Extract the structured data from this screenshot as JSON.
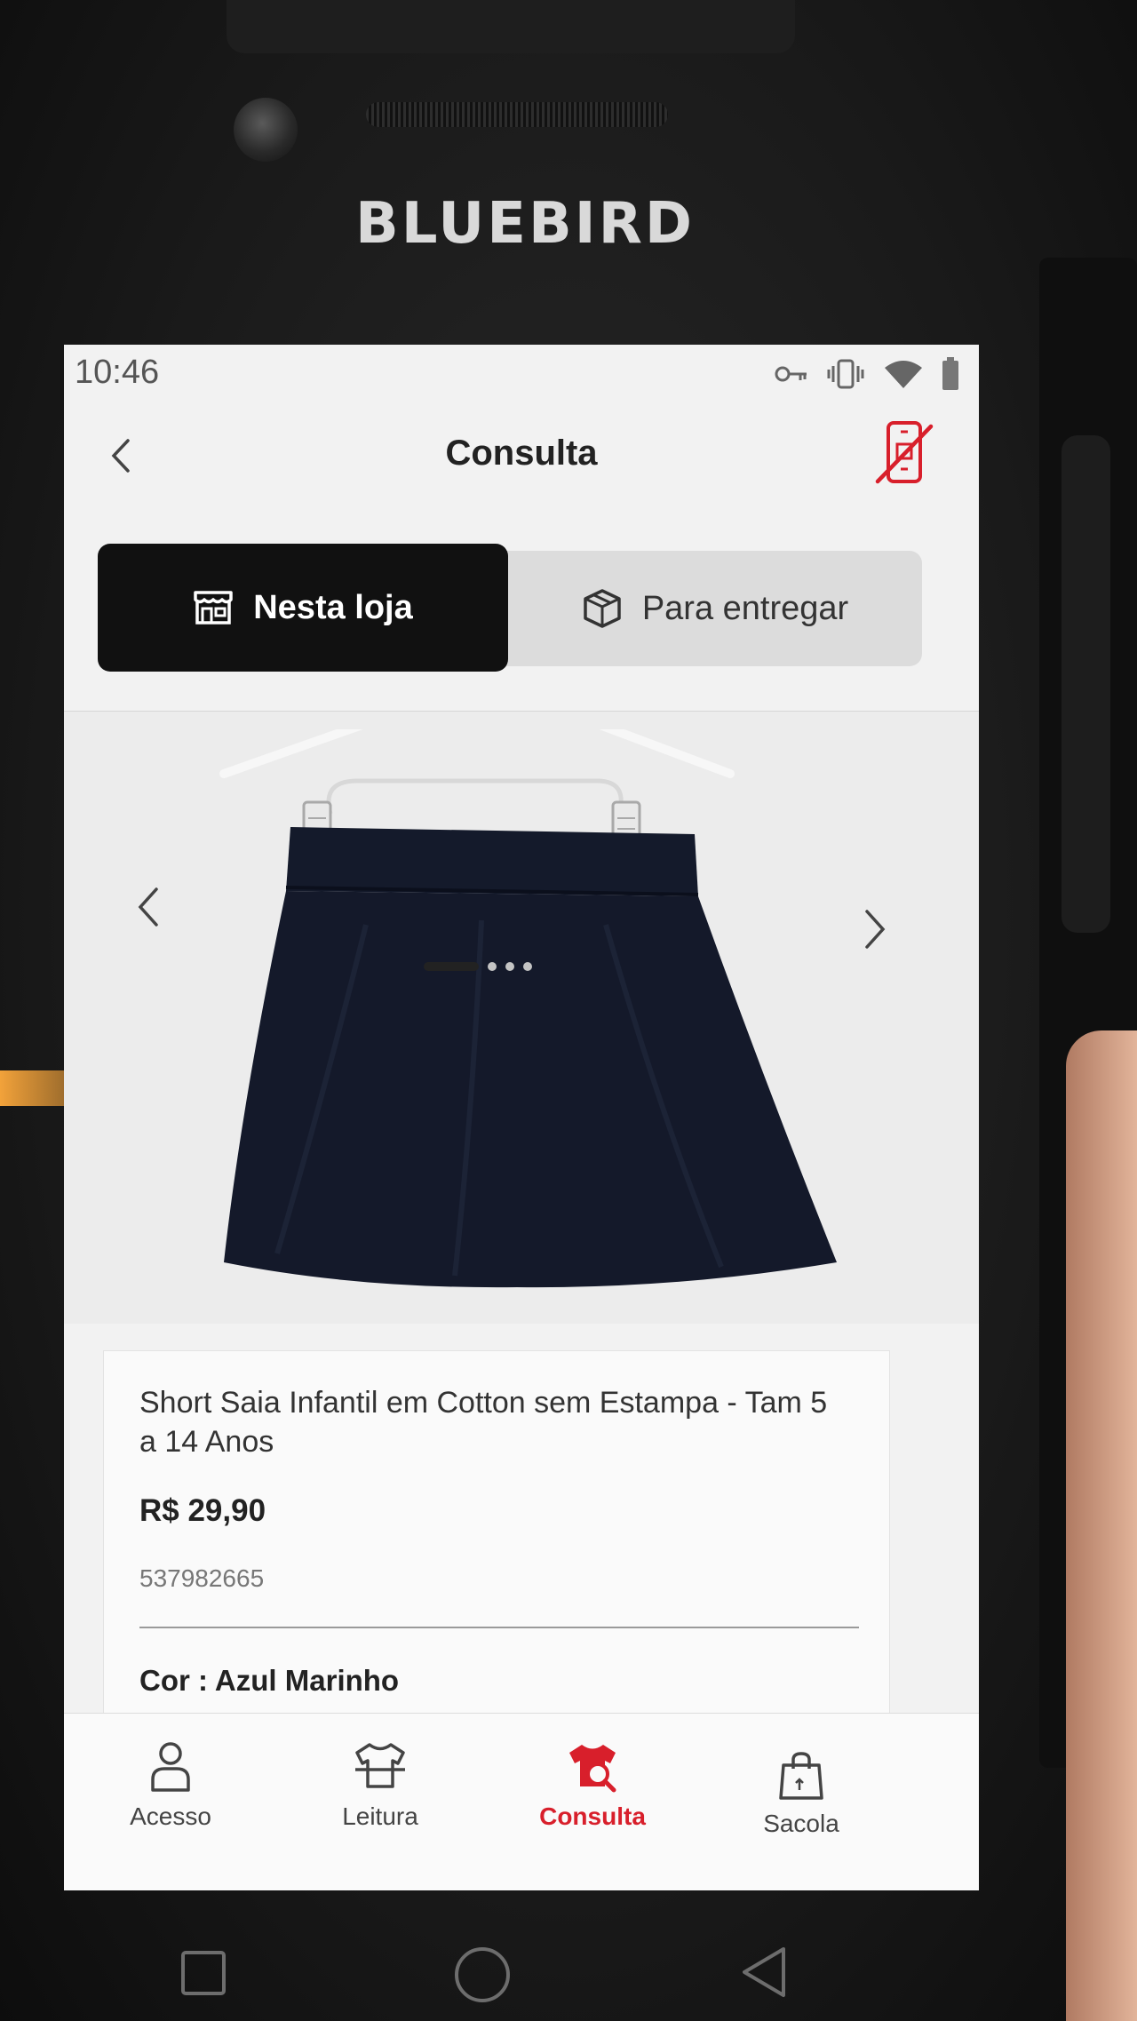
{
  "device": {
    "brand": "BLUEBIRD"
  },
  "status_bar": {
    "time": "10:46",
    "icons": [
      "key-icon",
      "vibrate-icon",
      "wifi-icon",
      "battery-icon"
    ]
  },
  "header": {
    "title": "Consulta",
    "back_icon": "chevron-left-icon",
    "action_icon": "scanner-off-icon"
  },
  "tabs": [
    {
      "label": "Nesta loja",
      "icon": "store-icon",
      "active": true
    },
    {
      "label": "Para entregar",
      "icon": "box-icon",
      "active": false
    }
  ],
  "carousel": {
    "image": "navy-skirt-on-hanger",
    "slide_count": 4,
    "current_slide": 1
  },
  "product": {
    "name": "Short Saia Infantil em Cotton sem Estampa - Tam 5 a 14 Anos",
    "price": "R$ 29,90",
    "sku": "537982665",
    "color_label": "Cor : Azul Marinho"
  },
  "bottom_nav": [
    {
      "label": "Acesso",
      "icon": "user-icon",
      "active": false
    },
    {
      "label": "Leitura",
      "icon": "tshirt-scan-icon",
      "active": false
    },
    {
      "label": "Consulta",
      "icon": "tshirt-search-icon",
      "active": true
    },
    {
      "label": "Sacola",
      "icon": "shopping-bag-icon",
      "active": false
    }
  ],
  "colors": {
    "accent": "#d81f2b",
    "active_tab_bg": "#111111",
    "skirt": "#14192a"
  }
}
